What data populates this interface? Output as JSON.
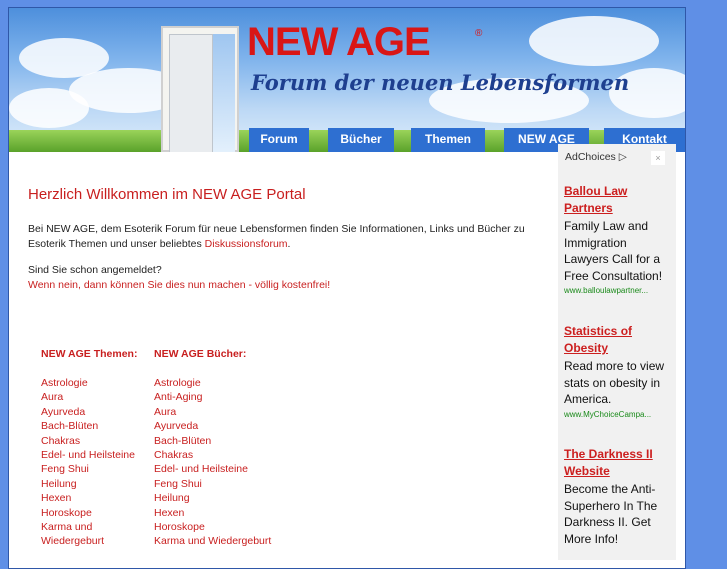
{
  "header": {
    "logo_title": "NEW AGE",
    "logo_reg": "®",
    "logo_subtitle": "Forum der neuen Lebensformen"
  },
  "nav": {
    "items": [
      {
        "label": "Forum"
      },
      {
        "label": "Bücher"
      },
      {
        "label": "Themen"
      },
      {
        "label": "NEW AGE"
      },
      {
        "label": "Kontakt"
      }
    ]
  },
  "main": {
    "welcome": "Herzlich Willkommen im NEW AGE Portal",
    "intro_text": "Bei NEW AGE, dem Esoterik Forum für neue Lebensformen finden Sie Informationen, Links und Bücher zu Esoterik Themen und unser beliebtes ",
    "intro_link": "Diskussionsforum",
    "intro_end": ".",
    "question": "Sind Sie schon angemeldet?",
    "register_text": "Wenn nein, dann können Sie dies nun machen - völlig kostenfrei!",
    "themen": {
      "heading": "NEW AGE Themen:",
      "items": [
        "Astrologie",
        "Aura",
        "Ayurveda",
        "Bach-Blüten",
        "Chakras",
        "Edel- und Heilsteine",
        "Feng Shui",
        "Heilung",
        "Hexen",
        "Horoskope",
        "Karma und",
        "Wiedergeburt"
      ]
    },
    "buecher": {
      "heading": "NEW AGE Bücher:",
      "items": [
        "Astrologie",
        "Anti-Aging",
        "Aura",
        "Ayurveda",
        "Bach-Blüten",
        "Chakras",
        "Edel- und Heilsteine",
        "Feng Shui",
        "Heilung",
        "Hexen",
        "Horoskope",
        "Karma und Wiedergeburt"
      ]
    }
  },
  "ads": {
    "adchoices": "AdChoices",
    "close": "×",
    "items": [
      {
        "title": "Ballou Law Partners",
        "body": "Family Law and Immigration Lawyers Call for a Free Consultation!",
        "url": "www.balloulawpartner..."
      },
      {
        "title": "Statistics of Obesity",
        "body": "Read more to view stats on obesity in America.",
        "url": "www.MyChoiceCampa..."
      },
      {
        "title": "The Darkness II Website",
        "body": "Become the Anti-Superhero In The Darkness II. Get More Info!",
        "url": ""
      }
    ]
  },
  "colors": {
    "background": "#5f8fe6",
    "accent_red": "#c81f1f",
    "nav_blue": "#2e6fd1",
    "ad_url_green": "#1a8a1a"
  }
}
